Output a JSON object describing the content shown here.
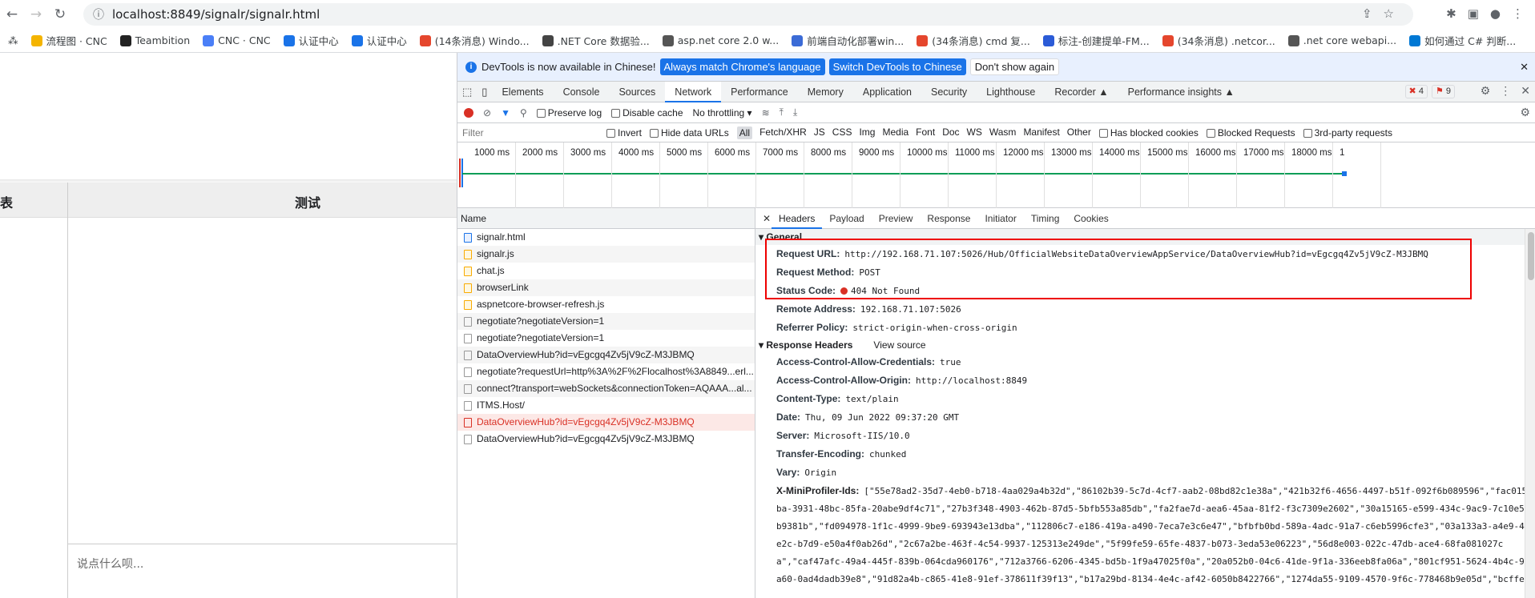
{
  "browser": {
    "url": "localhost:8849/signalr/signalr.html",
    "bookmarks": [
      {
        "label": "流程图 · CNC",
        "color": "#f4b400"
      },
      {
        "label": "Teambition",
        "color": "#222"
      },
      {
        "label": "CNC · CNC",
        "color": "#4a7ff7"
      },
      {
        "label": "认证中心",
        "color": "#1a73e8"
      },
      {
        "label": "认证中心",
        "color": "#1a73e8"
      },
      {
        "label": "(14条消息) Windo...",
        "color": "#e5462d"
      },
      {
        "label": ".NET Core 数据验...",
        "color": "#444"
      },
      {
        "label": "asp.net core 2.0 w...",
        "color": "#555"
      },
      {
        "label": "前端自动化部署win...",
        "color": "#3b6bd6"
      },
      {
        "label": "(34条消息) cmd 复...",
        "color": "#e5462d"
      },
      {
        "label": "标注-创建提单-FM...",
        "color": "#2b5bd7"
      },
      {
        "label": "(34条消息) .netcor...",
        "color": "#e5462d"
      },
      {
        "label": ".net core webapi...",
        "color": "#555"
      },
      {
        "label": "如何通过 C# 判断...",
        "color": "#0078d4"
      }
    ]
  },
  "page": {
    "header_left": "表",
    "header_right": "测试",
    "input_placeholder": "说点什么呗..."
  },
  "devtools": {
    "info": {
      "text": "DevTools is now available in Chinese!",
      "btn1": "Always match Chrome's language",
      "btn2": "Switch DevTools to Chinese",
      "btn3": "Don't show again"
    },
    "tabs": [
      "Elements",
      "Console",
      "Sources",
      "Network",
      "Performance",
      "Memory",
      "Application",
      "Security",
      "Lighthouse",
      "Recorder ▲",
      "Performance insights ▲"
    ],
    "errors": "4",
    "warnings": "9",
    "toolbar": {
      "preserve": "Preserve log",
      "disable": "Disable cache",
      "throttle": "No throttling"
    },
    "filter": {
      "placeholder": "Filter",
      "invert": "Invert",
      "hide": "Hide data URLs",
      "types": [
        "All",
        "Fetch/XHR",
        "JS",
        "CSS",
        "Img",
        "Media",
        "Font",
        "Doc",
        "WS",
        "Wasm",
        "Manifest",
        "Other"
      ],
      "blocked_cookies": "Has blocked cookies",
      "blocked_req": "Blocked Requests",
      "third": "3rd-party requests"
    },
    "timeline": [
      "1000 ms",
      "2000 ms",
      "3000 ms",
      "4000 ms",
      "5000 ms",
      "6000 ms",
      "7000 ms",
      "8000 ms",
      "9000 ms",
      "10000 ms",
      "11000 ms",
      "12000 ms",
      "13000 ms",
      "14000 ms",
      "15000 ms",
      "16000 ms",
      "17000 ms",
      "18000 ms",
      "1"
    ],
    "list_header": "Name",
    "requests": [
      {
        "name": "signalr.html",
        "type": "doc"
      },
      {
        "name": "signalr.js",
        "type": "js"
      },
      {
        "name": "chat.js",
        "type": "js"
      },
      {
        "name": "browserLink",
        "type": "js"
      },
      {
        "name": "aspnetcore-browser-refresh.js",
        "type": "js"
      },
      {
        "name": "negotiate?negotiateVersion=1",
        "type": "other"
      },
      {
        "name": "negotiate?negotiateVersion=1",
        "type": "other"
      },
      {
        "name": "DataOverviewHub?id=vEgcgq4Zv5jV9cZ-M3JBMQ",
        "type": "other"
      },
      {
        "name": "negotiate?requestUrl=http%3A%2F%2Flocalhost%3A8849...erl...",
        "type": "other"
      },
      {
        "name": "connect?transport=webSockets&connectionToken=AQAAA...al...",
        "type": "other"
      },
      {
        "name": "ITMS.Host/",
        "type": "other"
      },
      {
        "name": "DataOverviewHub?id=vEgcgq4Zv5jV9cZ-M3JBMQ",
        "type": "err"
      },
      {
        "name": "DataOverviewHub?id=vEgcgq4Zv5jV9cZ-M3JBMQ",
        "type": "other"
      }
    ],
    "detail_tabs": [
      "Headers",
      "Payload",
      "Preview",
      "Response",
      "Initiator",
      "Timing",
      "Cookies"
    ],
    "general_title": "General",
    "general": [
      {
        "k": "Request URL:",
        "v": "http://192.168.71.107:5026/Hub/OfficialWebsiteDataOverviewAppService/DataOverviewHub?id=vEgcgq4Zv5jV9cZ-M3JBMQ"
      },
      {
        "k": "Request Method:",
        "v": "POST"
      },
      {
        "k": "Status Code:",
        "v": "404 Not Found"
      },
      {
        "k": "Remote Address:",
        "v": "192.168.71.107:5026"
      },
      {
        "k": "Referrer Policy:",
        "v": "strict-origin-when-cross-origin"
      }
    ],
    "resp_title": "Response Headers",
    "view_source": "View source",
    "resp": [
      {
        "k": "Access-Control-Allow-Credentials:",
        "v": "true"
      },
      {
        "k": "Access-Control-Allow-Origin:",
        "v": "http://localhost:8849"
      },
      {
        "k": "Content-Type:",
        "v": "text/plain"
      },
      {
        "k": "Date:",
        "v": "Thu, 09 Jun 2022 09:37:20 GMT"
      },
      {
        "k": "Server:",
        "v": "Microsoft-IIS/10.0"
      },
      {
        "k": "Transfer-Encoding:",
        "v": "chunked"
      },
      {
        "k": "Vary:",
        "v": "Origin"
      }
    ],
    "mp_key": "X-MiniProfiler-Ids:",
    "mp_val": "[\"55e78ad2-35d7-4eb0-b718-4aa029a4b32d\",\"86102b39-5c7d-4cf7-aab2-08bd82c1e38a\",\"421b32f6-4656-4497-b51f-092f6b089596\",\"fac015ba-3931-48bc-85fa-20abe9df4c71\",\"27b3f348-4903-462b-87d5-5bfb553a85db\",\"fa2fae7d-aea6-45aa-81f2-f3c7309e2602\",\"30a15165-e599-434c-9ac9-7c10e5b9381b\",\"fd094978-1f1c-4999-9be9-693943e13dba\",\"112806c7-e186-419a-a490-7eca7e3c6e47\",\"bfbfb0bd-589a-4adc-91a7-c6eb5996cfe3\",\"03a133a3-a4e9-4e2c-b7d9-e50a4f0ab26d\",\"2c67a2be-463f-4c54-9937-125313e249de\",\"5f99fe59-65fe-4837-b073-3eda53e06223\",\"56d8e003-022c-47db-ace4-68fa081027ca\",\"caf47afc-49a4-445f-839b-064cda960176\",\"712a3766-6206-4345-bd5b-1f9a47025f0a\",\"20a052b0-04c6-41de-9f1a-336eeb8fa06a\",\"801cf951-5624-4b4c-9a60-0ad4dadb39e8\",\"91d82a4b-c865-41e8-91ef-378611f39f13\",\"b17a29bd-8134-4e4c-af42-6050b8422766\",\"1274da55-9109-4570-9f6c-778468b9e05d\",\"bcffe"
  }
}
